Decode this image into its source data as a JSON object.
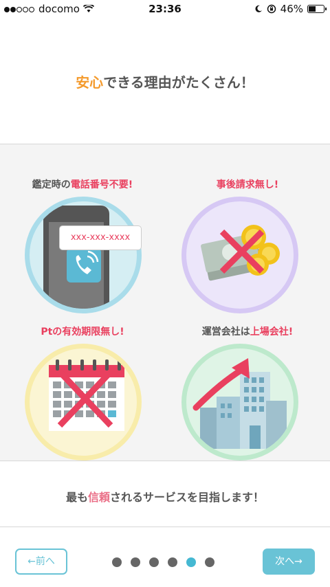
{
  "status_bar": {
    "carrier": "docomo",
    "time": "23:36",
    "battery": "46%"
  },
  "headline": {
    "highlight": "安心",
    "rest": "できる理由がたくさん！"
  },
  "features": [
    {
      "caption_plain": "鑑定時の",
      "caption_red": "電話番号不要!",
      "bubble_text": "xxx-xxx-xxxx"
    },
    {
      "caption_plain": "",
      "caption_red": "事後請求無し!"
    },
    {
      "caption_plain": "",
      "caption_red": "Ptの有効期限無し!"
    },
    {
      "caption_plain": "運営会社は",
      "caption_red": "上場会社!"
    }
  ],
  "footer_message": {
    "pre": "最も",
    "highlight": "信頼",
    "post": "されるサービスを目指します！"
  },
  "navigation": {
    "prev_label": "←前へ",
    "next_label": "次へ→",
    "page_count": 6,
    "current_page": 5
  },
  "colors": {
    "accent": "#69c3d6",
    "red": "#e9405f",
    "orange": "#f49a2c"
  }
}
